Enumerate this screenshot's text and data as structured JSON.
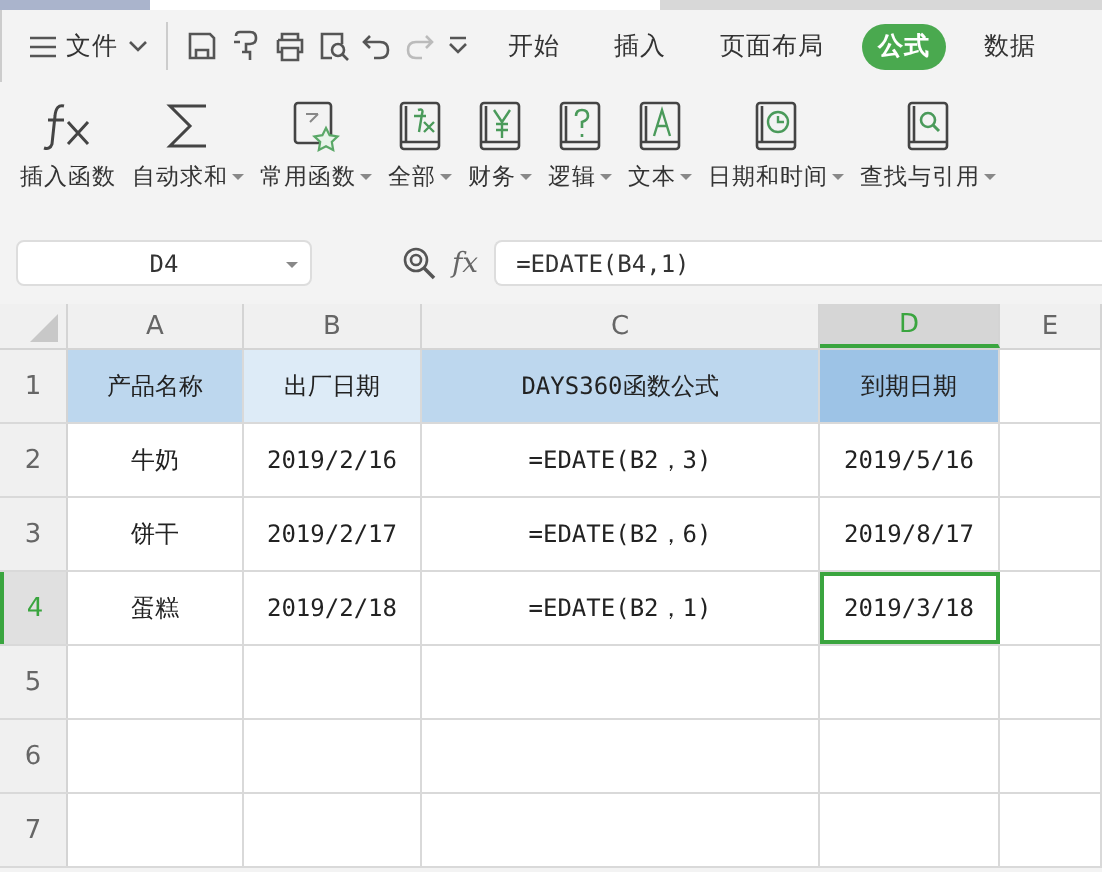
{
  "menu": {
    "file_label": "文件",
    "tabs": [
      {
        "label": "开始",
        "selected": false
      },
      {
        "label": "插入",
        "selected": false
      },
      {
        "label": "页面布局",
        "selected": false
      },
      {
        "label": "公式",
        "selected": true
      },
      {
        "label": "数据",
        "selected": false
      }
    ]
  },
  "ribbon": [
    {
      "label": "插入函数",
      "kind": "fx",
      "dropdown": false
    },
    {
      "label": "自动求和",
      "kind": "sum",
      "dropdown": true
    },
    {
      "label": "常用函数",
      "kind": "star",
      "dropdown": true
    },
    {
      "label": "全部",
      "kind": "book-fx",
      "dropdown": true
    },
    {
      "label": "财务",
      "kind": "yen",
      "dropdown": true
    },
    {
      "label": "逻辑",
      "kind": "question",
      "dropdown": true
    },
    {
      "label": "文本",
      "kind": "letter",
      "dropdown": true
    },
    {
      "label": "日期和时间",
      "kind": "clock",
      "dropdown": true
    },
    {
      "label": "查找与引用",
      "kind": "search",
      "dropdown": true
    }
  ],
  "formula_bar": {
    "name_box": "D4",
    "fx_label": "fx",
    "formula": "=EDATE(B4,1)"
  },
  "columns": [
    {
      "label": "A",
      "selected": false
    },
    {
      "label": "B",
      "selected": false
    },
    {
      "label": "C",
      "selected": false
    },
    {
      "label": "D",
      "selected": true
    },
    {
      "label": "E",
      "selected": false
    }
  ],
  "rows": [
    {
      "number": "1",
      "selected": false,
      "cells": [
        {
          "text": "产品名称",
          "color": "#bdd7ee",
          "selected": false
        },
        {
          "text": "出厂日期",
          "color": "#ddebf7",
          "selected": false
        },
        {
          "text": "DAYS360函数公式",
          "color": "#bdd7ee",
          "selected": false
        },
        {
          "text": "到期日期",
          "color": "#9dc3e6",
          "selected": false
        }
      ]
    },
    {
      "number": "2",
      "selected": false,
      "cells": [
        {
          "text": "牛奶",
          "selected": false
        },
        {
          "text": "2019/2/16",
          "selected": false
        },
        {
          "text": "=EDATE(B2，3)",
          "selected": false
        },
        {
          "text": "2019/5/16",
          "selected": false
        }
      ]
    },
    {
      "number": "3",
      "selected": false,
      "cells": [
        {
          "text": "饼干",
          "selected": false
        },
        {
          "text": "2019/2/17",
          "selected": false
        },
        {
          "text": "=EDATE(B2，6)",
          "selected": false
        },
        {
          "text": "2019/8/17",
          "selected": false
        }
      ]
    },
    {
      "number": "4",
      "selected": true,
      "cells": [
        {
          "text": "蛋糕",
          "selected": false
        },
        {
          "text": "2019/2/18",
          "selected": false
        },
        {
          "text": "=EDATE(B2，1)",
          "selected": false
        },
        {
          "text": "2019/3/18",
          "selected": true
        }
      ]
    },
    {
      "number": "5",
      "selected": false
    },
    {
      "number": "6",
      "selected": false
    },
    {
      "number": "7",
      "selected": false
    }
  ]
}
